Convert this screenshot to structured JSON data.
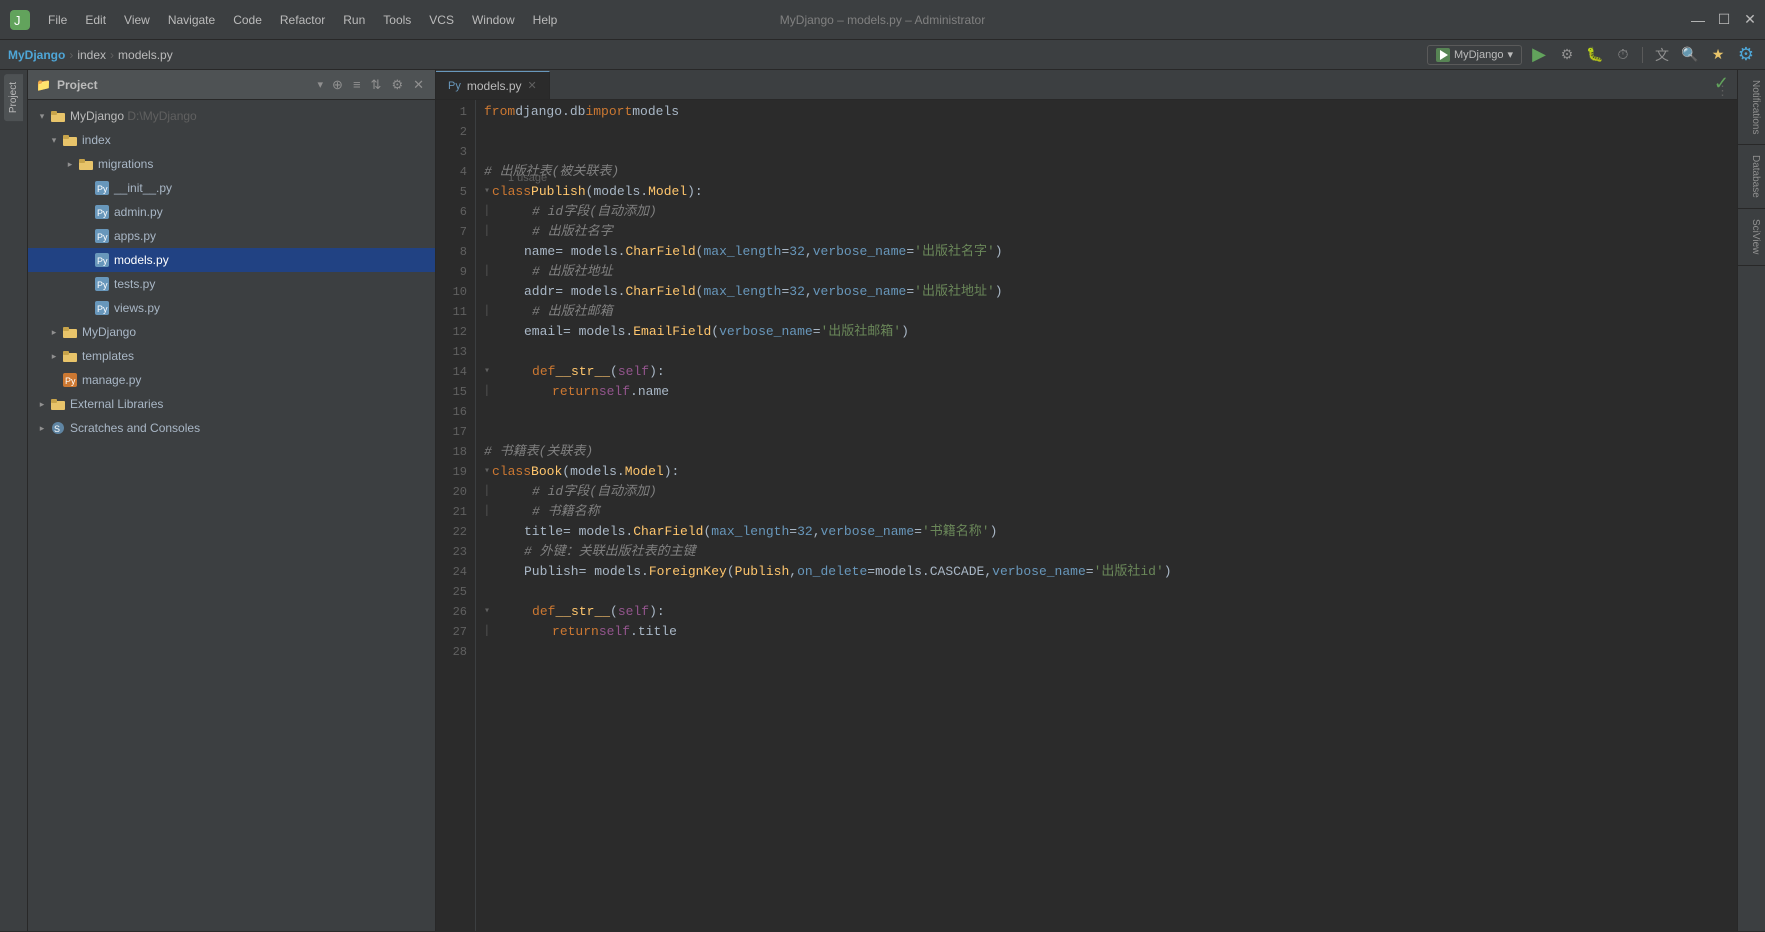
{
  "titleBar": {
    "appTitle": "MyDjango – models.py – Administrator",
    "menus": [
      "File",
      "Edit",
      "View",
      "Navigate",
      "Code",
      "Refactor",
      "Run",
      "Tools",
      "VCS",
      "Window",
      "Help"
    ],
    "windowControls": [
      "—",
      "☐",
      "✕"
    ]
  },
  "breadcrumb": {
    "project": "MyDjango",
    "separator1": "›",
    "index": "index",
    "separator2": "›",
    "file": "models.py",
    "runConfig": "MyDjango",
    "runConfigArrow": "▾"
  },
  "projectPanel": {
    "title": "Project",
    "titleArrow": "▾",
    "items": [
      {
        "id": "mydjango-root",
        "label": "MyDjango",
        "path": "D:\\MyDjango",
        "indent": 1,
        "type": "folder",
        "expanded": true
      },
      {
        "id": "index-folder",
        "label": "index",
        "indent": 2,
        "type": "folder",
        "expanded": true
      },
      {
        "id": "migrations-folder",
        "label": "migrations",
        "indent": 3,
        "type": "folder",
        "expanded": false
      },
      {
        "id": "init-py",
        "label": "__init__.py",
        "indent": 4,
        "type": "py"
      },
      {
        "id": "admin-py",
        "label": "admin.py",
        "indent": 4,
        "type": "py"
      },
      {
        "id": "apps-py",
        "label": "apps.py",
        "indent": 4,
        "type": "py"
      },
      {
        "id": "models-py",
        "label": "models.py",
        "indent": 4,
        "type": "py",
        "selected": true
      },
      {
        "id": "tests-py",
        "label": "tests.py",
        "indent": 4,
        "type": "py"
      },
      {
        "id": "views-py",
        "label": "views.py",
        "indent": 4,
        "type": "py"
      },
      {
        "id": "mydjango-folder",
        "label": "MyDjango",
        "indent": 2,
        "type": "folder",
        "expanded": false
      },
      {
        "id": "templates-folder",
        "label": "templates",
        "indent": 2,
        "type": "folder",
        "expanded": false
      },
      {
        "id": "manage-py",
        "label": "manage.py",
        "indent": 2,
        "type": "py-orange"
      },
      {
        "id": "external-libs",
        "label": "External Libraries",
        "indent": 1,
        "type": "folder",
        "expanded": false
      },
      {
        "id": "scratches",
        "label": "Scratches and Consoles",
        "indent": 1,
        "type": "scratches",
        "expanded": false
      }
    ]
  },
  "tabs": [
    {
      "label": "models.py",
      "active": true,
      "icon": "py"
    }
  ],
  "codeLines": [
    {
      "num": 1,
      "tokens": [
        {
          "t": "kw",
          "v": "from"
        },
        {
          "t": "base",
          "v": " django.db "
        },
        {
          "t": "kw",
          "v": "import"
        },
        {
          "t": "base",
          "v": " models"
        }
      ]
    },
    {
      "num": 2,
      "tokens": []
    },
    {
      "num": 3,
      "tokens": []
    },
    {
      "num": 4,
      "tokens": [
        {
          "t": "cmt",
          "v": "# 出版社表(被关联表)"
        }
      ]
    },
    {
      "num": 5,
      "usageHint": "1 usage",
      "fold": true,
      "tokens": [
        {
          "t": "kw",
          "v": "class"
        },
        {
          "t": "base",
          "v": " "
        },
        {
          "t": "cls",
          "v": "Publish"
        },
        {
          "t": "paren",
          "v": "("
        },
        {
          "t": "base",
          "v": "models"
        },
        {
          "t": "dot",
          "v": "."
        },
        {
          "t": "cls",
          "v": "Model"
        },
        {
          "t": "paren",
          "v": ")"
        },
        {
          "t": "base",
          "v": ":"
        }
      ]
    },
    {
      "num": 6,
      "indent": 2,
      "tokens": [
        {
          "t": "cmt",
          "v": "# id字段(自动添加)"
        }
      ],
      "gutterFold": true
    },
    {
      "num": 7,
      "indent": 2,
      "tokens": [
        {
          "t": "cmt",
          "v": "# 出版社名字"
        }
      ],
      "gutterFold": true
    },
    {
      "num": 8,
      "indent": 2,
      "tokens": [
        {
          "t": "base",
          "v": "name "
        },
        {
          "t": "base",
          "v": "= models."
        },
        {
          "t": "cls",
          "v": "CharField"
        },
        {
          "t": "paren",
          "v": "("
        },
        {
          "t": "param",
          "v": "max_length"
        },
        {
          "t": "base",
          "v": "="
        },
        {
          "t": "num",
          "v": "32"
        },
        {
          "t": "base",
          "v": ", "
        },
        {
          "t": "param",
          "v": "verbose_name"
        },
        {
          "t": "base",
          "v": "="
        },
        {
          "t": "str",
          "v": "'出版社名字'"
        },
        {
          "t": "paren",
          "v": ")"
        }
      ]
    },
    {
      "num": 9,
      "indent": 2,
      "tokens": [
        {
          "t": "cmt",
          "v": "# 出版社地址"
        }
      ],
      "gutterFold": true
    },
    {
      "num": 10,
      "indent": 2,
      "tokens": [
        {
          "t": "base",
          "v": "addr "
        },
        {
          "t": "base",
          "v": "= models."
        },
        {
          "t": "cls",
          "v": "CharField"
        },
        {
          "t": "paren",
          "v": "("
        },
        {
          "t": "param",
          "v": "max_length"
        },
        {
          "t": "base",
          "v": "="
        },
        {
          "t": "num",
          "v": "32"
        },
        {
          "t": "base",
          "v": ", "
        },
        {
          "t": "param",
          "v": "verbose_name"
        },
        {
          "t": "base",
          "v": "="
        },
        {
          "t": "str",
          "v": "'出版社地址'"
        },
        {
          "t": "paren",
          "v": ")"
        }
      ]
    },
    {
      "num": 11,
      "indent": 2,
      "tokens": [
        {
          "t": "cmt",
          "v": "# 出版社邮箱"
        }
      ],
      "gutterFold": true
    },
    {
      "num": 12,
      "indent": 2,
      "tokens": [
        {
          "t": "base",
          "v": "email "
        },
        {
          "t": "base",
          "v": "= models."
        },
        {
          "t": "cls",
          "v": "EmailField"
        },
        {
          "t": "paren",
          "v": "("
        },
        {
          "t": "param",
          "v": "verbose_name"
        },
        {
          "t": "base",
          "v": "="
        },
        {
          "t": "str",
          "v": "'出版社邮箱'"
        },
        {
          "t": "paren",
          "v": ")"
        }
      ]
    },
    {
      "num": 13,
      "tokens": []
    },
    {
      "num": 14,
      "indent": 2,
      "bp": true,
      "fold": true,
      "tokens": [
        {
          "t": "kw",
          "v": "def"
        },
        {
          "t": "base",
          "v": " "
        },
        {
          "t": "fn",
          "v": "__str__"
        },
        {
          "t": "paren",
          "v": "("
        },
        {
          "t": "self-kw",
          "v": "self"
        },
        {
          "t": "paren",
          "v": ")"
        },
        {
          "t": "base",
          "v": ":"
        }
      ]
    },
    {
      "num": 15,
      "indent": 3,
      "gutterFold": true,
      "tokens": [
        {
          "t": "kw",
          "v": "return"
        },
        {
          "t": "base",
          "v": " "
        },
        {
          "t": "self-kw",
          "v": "self"
        },
        {
          "t": "dot",
          "v": "."
        },
        {
          "t": "base",
          "v": "name"
        }
      ]
    },
    {
      "num": 16,
      "tokens": []
    },
    {
      "num": 17,
      "tokens": []
    },
    {
      "num": 18,
      "tokens": [
        {
          "t": "cmt",
          "v": "# 书籍表(关联表)"
        }
      ]
    },
    {
      "num": 19,
      "fold": true,
      "tokens": [
        {
          "t": "kw",
          "v": "class"
        },
        {
          "t": "base",
          "v": " "
        },
        {
          "t": "cls",
          "v": "Book"
        },
        {
          "t": "paren",
          "v": "("
        },
        {
          "t": "base",
          "v": "models"
        },
        {
          "t": "dot",
          "v": "."
        },
        {
          "t": "cls",
          "v": "Model"
        },
        {
          "t": "paren",
          "v": ")"
        },
        {
          "t": "base",
          "v": ":"
        }
      ]
    },
    {
      "num": 20,
      "indent": 2,
      "gutterFold": true,
      "tokens": [
        {
          "t": "cmt",
          "v": "# id字段(自动添加)"
        }
      ]
    },
    {
      "num": 21,
      "indent": 2,
      "gutterFold": true,
      "tokens": [
        {
          "t": "cmt",
          "v": "# 书籍名称"
        }
      ]
    },
    {
      "num": 22,
      "indent": 2,
      "tokens": [
        {
          "t": "base",
          "v": "title "
        },
        {
          "t": "base",
          "v": "= models."
        },
        {
          "t": "cls",
          "v": "CharField"
        },
        {
          "t": "paren",
          "v": "("
        },
        {
          "t": "param",
          "v": "max_length"
        },
        {
          "t": "base",
          "v": "="
        },
        {
          "t": "num",
          "v": "32"
        },
        {
          "t": "base",
          "v": ", "
        },
        {
          "t": "param",
          "v": "verbose_name"
        },
        {
          "t": "base",
          "v": "="
        },
        {
          "t": "str",
          "v": "'书籍名称'"
        },
        {
          "t": "paren",
          "v": ")"
        }
      ]
    },
    {
      "num": 23,
      "indent": 2,
      "tokens": [
        {
          "t": "cmt",
          "v": "# 外键：关联出版社表的主键"
        }
      ]
    },
    {
      "num": 24,
      "indent": 2,
      "tokens": [
        {
          "t": "base",
          "v": "Publish "
        },
        {
          "t": "base",
          "v": "= models."
        },
        {
          "t": "cls",
          "v": "ForeignKey"
        },
        {
          "t": "paren",
          "v": "("
        },
        {
          "t": "cls",
          "v": "Publish"
        },
        {
          "t": "base",
          "v": ", "
        },
        {
          "t": "param",
          "v": "on_delete"
        },
        {
          "t": "base",
          "v": "=models."
        },
        {
          "t": "base",
          "v": "CASCADE, "
        },
        {
          "t": "param",
          "v": "verbose_name"
        },
        {
          "t": "base",
          "v": "="
        },
        {
          "t": "str",
          "v": "'出版社id'"
        },
        {
          "t": "paren",
          "v": ")"
        }
      ]
    },
    {
      "num": 25,
      "tokens": []
    },
    {
      "num": 26,
      "indent": 2,
      "bp": true,
      "fold": true,
      "tokens": [
        {
          "t": "kw",
          "v": "def"
        },
        {
          "t": "base",
          "v": " "
        },
        {
          "t": "fn",
          "v": "__str__"
        },
        {
          "t": "paren",
          "v": "("
        },
        {
          "t": "self-kw",
          "v": "self"
        },
        {
          "t": "paren",
          "v": ")"
        },
        {
          "t": "base",
          "v": ":"
        }
      ]
    },
    {
      "num": 27,
      "indent": 3,
      "gutterFold": true,
      "tokens": [
        {
          "t": "kw",
          "v": "return"
        },
        {
          "t": "base",
          "v": " "
        },
        {
          "t": "self-kw",
          "v": "self"
        },
        {
          "t": "dot",
          "v": "."
        },
        {
          "t": "base",
          "v": "title"
        }
      ]
    },
    {
      "num": 28,
      "tokens": []
    }
  ],
  "rightPanels": [
    "Notifications",
    "Database",
    "SciView"
  ],
  "checkmark": "✓"
}
